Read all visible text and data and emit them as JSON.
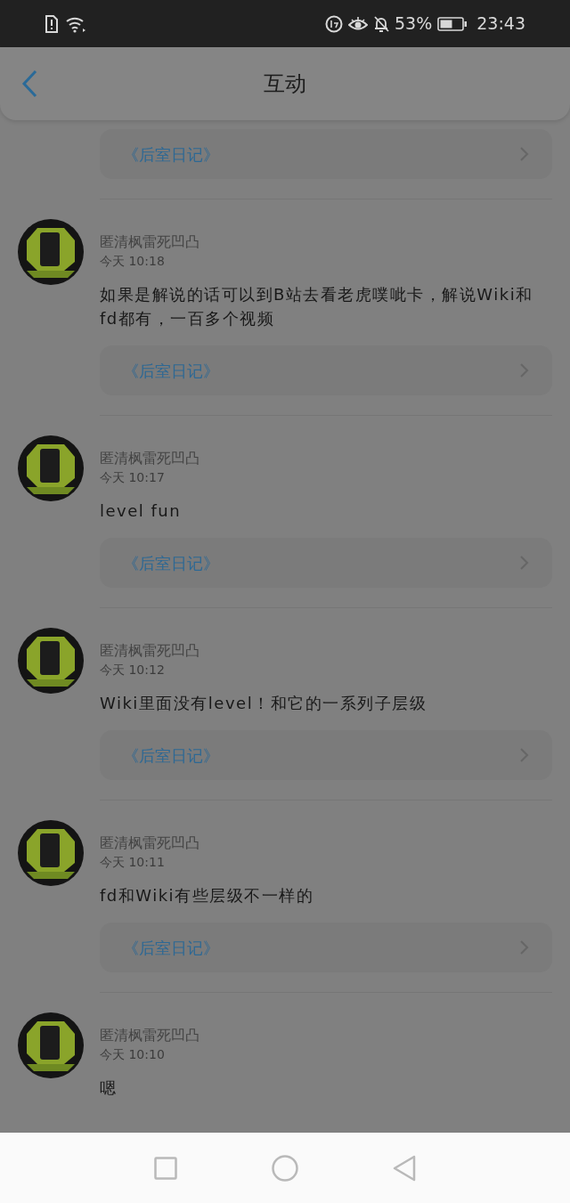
{
  "status_bar": {
    "battery": "53%",
    "time": "23:43"
  },
  "header": {
    "title": "互动"
  },
  "comments": [
    {
      "link": "《后室日记》"
    },
    {
      "author": "匿清枫雷死凹凸",
      "time": "今天 10:18",
      "text": "如果是解说的话可以到B站去看老虎噗呲卡，解说Wiki和fd都有，一百多个视频",
      "link": "《后室日记》"
    },
    {
      "author": "匿清枫雷死凹凸",
      "time": "今天 10:17",
      "text": "level fun",
      "link": "《后室日记》"
    },
    {
      "author": "匿清枫雷死凹凸",
      "time": "今天 10:12",
      "text": "Wiki里面没有level！和它的一系列子层级",
      "link": "《后室日记》"
    },
    {
      "author": "匿清枫雷死凹凸",
      "time": "今天 10:11",
      "text": "fd和Wiki有些层级不一样的",
      "link": "《后室日记》"
    },
    {
      "author": "匿清枫雷死凹凸",
      "time": "今天 10:10",
      "text": "嗯"
    }
  ]
}
